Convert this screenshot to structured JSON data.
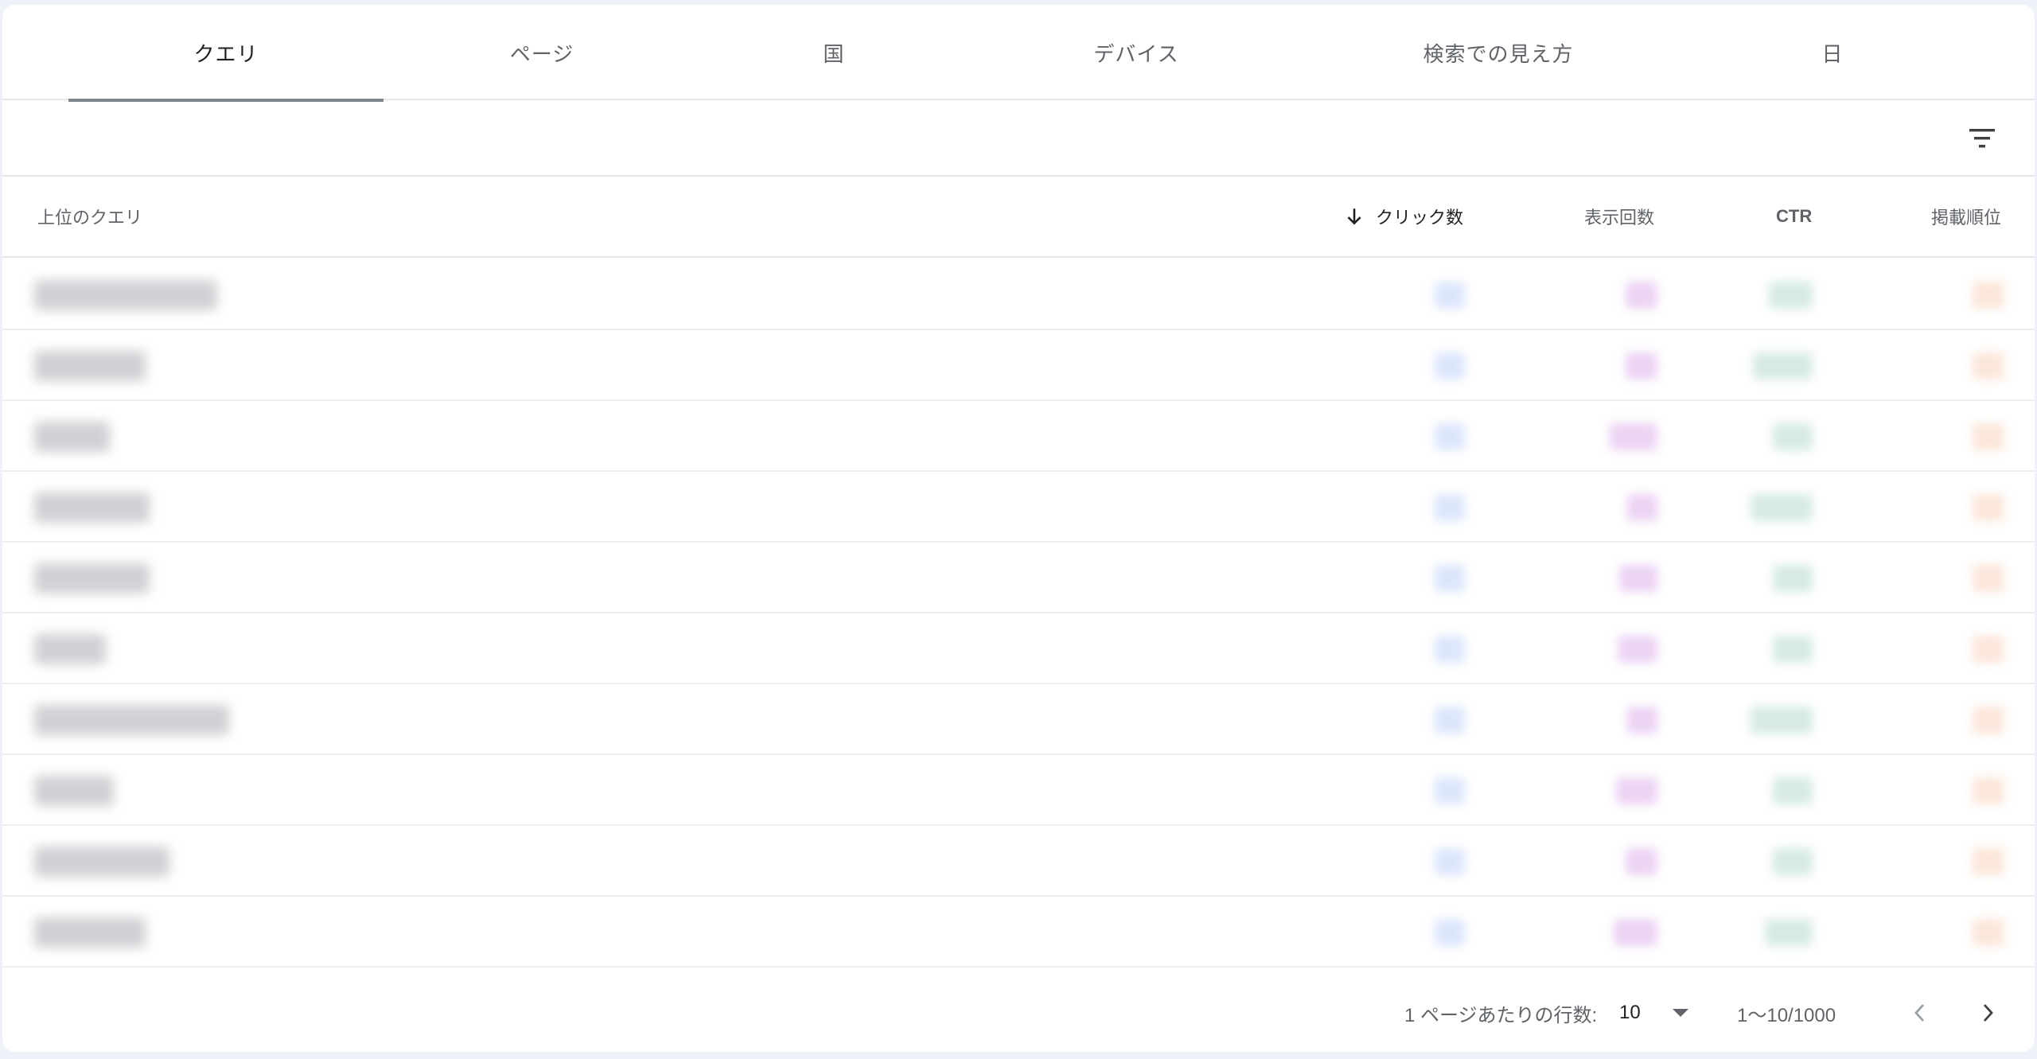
{
  "tabs": [
    {
      "label": "クエリ",
      "active": true
    },
    {
      "label": "ページ",
      "active": false
    },
    {
      "label": "国",
      "active": false
    },
    {
      "label": "デバイス",
      "active": false
    },
    {
      "label": "検索での見え方",
      "active": false
    },
    {
      "label": "日",
      "active": false
    }
  ],
  "filter": {
    "icon": "filter-icon"
  },
  "table": {
    "columns": {
      "query": "上位のクエリ",
      "clicks": "クリック数",
      "impressions": "表示回数",
      "ctr": "CTR",
      "position": "掲載順位"
    },
    "sort_icon": "arrow-down-icon",
    "row_count": 10
  },
  "footer": {
    "rows_per_page_label": "1 ページあたりの行数:",
    "rows_per_page_value": "10",
    "range": "1～10/1000",
    "prev_icon": "chevron-left-icon",
    "next_icon": "chevron-right-icon"
  },
  "colors": {
    "clicks": "#dce6fb",
    "impressions": "#ecd3f3",
    "ctr": "#d6ebe2",
    "position": "#fbe6d9"
  }
}
